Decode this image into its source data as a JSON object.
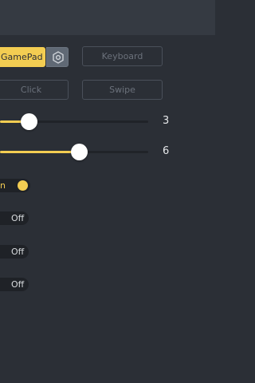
{
  "mode_buttons": {
    "gamepad_label": "GamePad",
    "keyboard_label": "Keyboard",
    "click_label": "Click",
    "swipe_label": "Swipe"
  },
  "sliders": [
    {
      "value": 3,
      "fill_fraction": 0.2
    },
    {
      "value": 6,
      "fill_fraction": 0.54
    }
  ],
  "toggles": {
    "first": {
      "label": "On",
      "visible_text": "n",
      "state": true
    },
    "second": {
      "label": "Off",
      "state": false
    },
    "third": {
      "label": "Off",
      "state": false
    },
    "fourth": {
      "label": "Off",
      "state": false
    }
  },
  "icons": {
    "settings": "hexagon-gear-icon"
  },
  "colors": {
    "accent": "#f3cd52",
    "background": "#2b2f36",
    "topbar": "#353a42"
  }
}
